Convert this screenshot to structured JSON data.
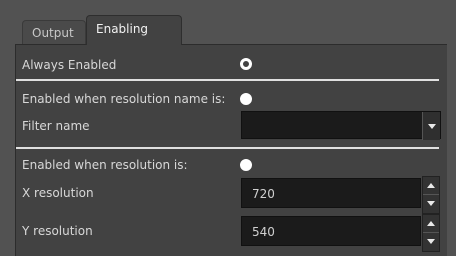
{
  "tabs": [
    {
      "label": "Output",
      "active": false
    },
    {
      "label": "Enabling",
      "active": true
    }
  ],
  "options": {
    "always_enabled": {
      "label": "Always Enabled",
      "selected": true
    },
    "by_name": {
      "label": "Enabled when resolution name is:",
      "selected": false
    },
    "by_resolution": {
      "label": "Enabled when resolution is:",
      "selected": false
    }
  },
  "filter": {
    "label": "Filter name",
    "value": ""
  },
  "x_resolution": {
    "label": "X resolution",
    "value": "720"
  },
  "y_resolution": {
    "label": "Y resolution",
    "value": "540"
  },
  "colors": {
    "background": "#525252",
    "panel": "#424242",
    "field": "#1b1b1b"
  }
}
